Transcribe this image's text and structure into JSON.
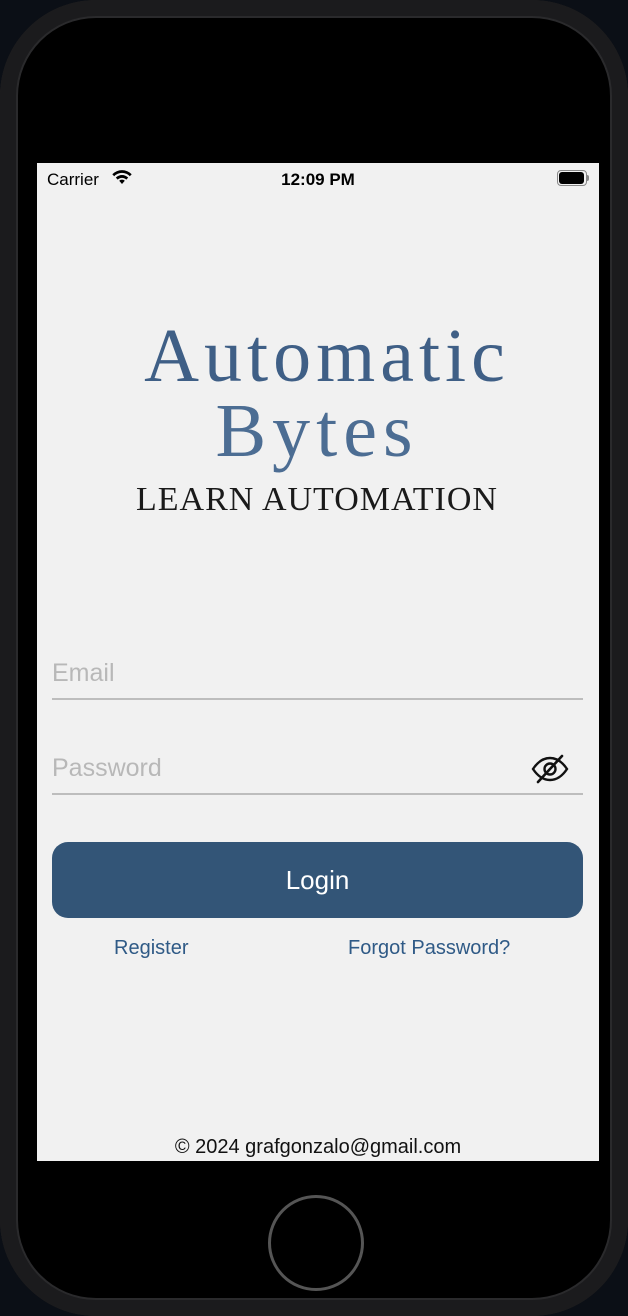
{
  "status_bar": {
    "carrier": "Carrier",
    "time": "12:09 PM"
  },
  "logo": {
    "line1": "Automatic",
    "line2": "Bytes",
    "line3": "LEARN AUTOMATION"
  },
  "form": {
    "email_placeholder": "Email",
    "email_value": "",
    "password_placeholder": "Password",
    "password_value": "",
    "login_label": "Login",
    "register_label": "Register",
    "forgot_label": "Forgot Password?"
  },
  "footer": {
    "text": "© 2024 grafgonzalo@gmail.com"
  },
  "icons": {
    "wifi": "wifi-icon",
    "battery": "battery-icon",
    "toggle_password": "eye-slash-icon"
  },
  "colors": {
    "primary": "#335577",
    "link": "#2f5a86",
    "logo": "#3f5f86",
    "background": "#f1f1f1"
  }
}
